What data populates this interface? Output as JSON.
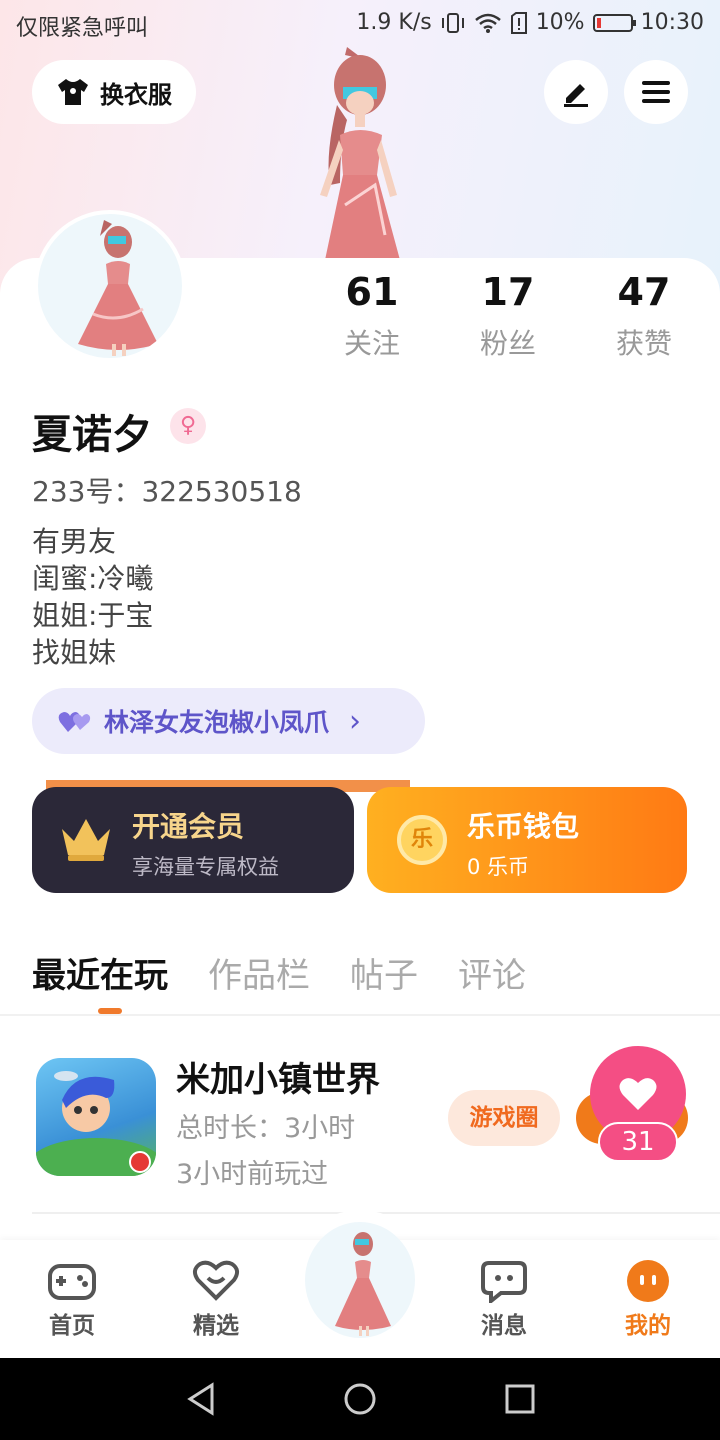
{
  "status_bar": {
    "left_text": "仅限紧急呼叫",
    "speed": "1.9 K/s",
    "battery": "10%",
    "time": "10:30"
  },
  "header": {
    "outfit_label": "换衣服"
  },
  "profile": {
    "stats": [
      {
        "value": "61",
        "label": "关注"
      },
      {
        "value": "17",
        "label": "粉丝"
      },
      {
        "value": "47",
        "label": "获赞"
      }
    ],
    "name": "夏诺夕",
    "gender_symbol": "♀",
    "uid": "233号：322530518",
    "bio": [
      "有男友",
      "闺蜜:冷曦",
      "姐姐:于宝",
      "找姐妹"
    ],
    "cp_label": "林泽女友泡椒小凤爪",
    "cp_arrow": "›"
  },
  "cards": {
    "vip_title": "开通会员",
    "vip_sub": "享海量专属权益",
    "wallet_title": "乐币钱包",
    "wallet_sub": "0 乐币",
    "wallet_coin": "乐"
  },
  "tabs": [
    "最近在玩",
    "作品栏",
    "帖子",
    "评论"
  ],
  "recent_game": {
    "name": "米加小镇世界",
    "duration": "总时长：3小时",
    "last_played": "3小时前玩过",
    "circle_label": "游戏圈",
    "likes": "31"
  },
  "nav": {
    "home": "首页",
    "featured": "精选",
    "messages": "消息",
    "mine": "我的"
  },
  "colors": {
    "accent": "#f07a2c",
    "like": "#f44e84",
    "cp_text": "#5e55c9",
    "vip_bg": "#2b2838"
  }
}
